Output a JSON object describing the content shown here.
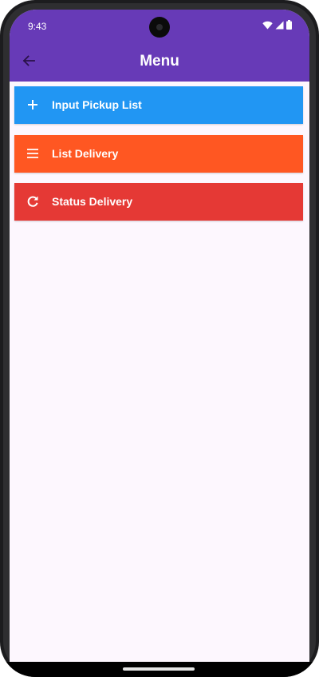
{
  "status_bar": {
    "time": "9:43",
    "icons": [
      "wifi-icon",
      "signal-icon",
      "battery-icon"
    ]
  },
  "app_bar": {
    "title": "Menu",
    "back_icon": "arrow-left-icon",
    "background": "#673ab7"
  },
  "menu": {
    "items": [
      {
        "label": "Input Pickup List",
        "icon": "plus-icon",
        "color": "#2196f3"
      },
      {
        "label": "List Delivery",
        "icon": "menu-lines-icon",
        "color": "#ff5722"
      },
      {
        "label": "Status Delivery",
        "icon": "refresh-icon",
        "color": "#e53935"
      }
    ]
  },
  "colors": {
    "screen_background": "#fdf7fe",
    "text_on_color": "#ffffff"
  }
}
